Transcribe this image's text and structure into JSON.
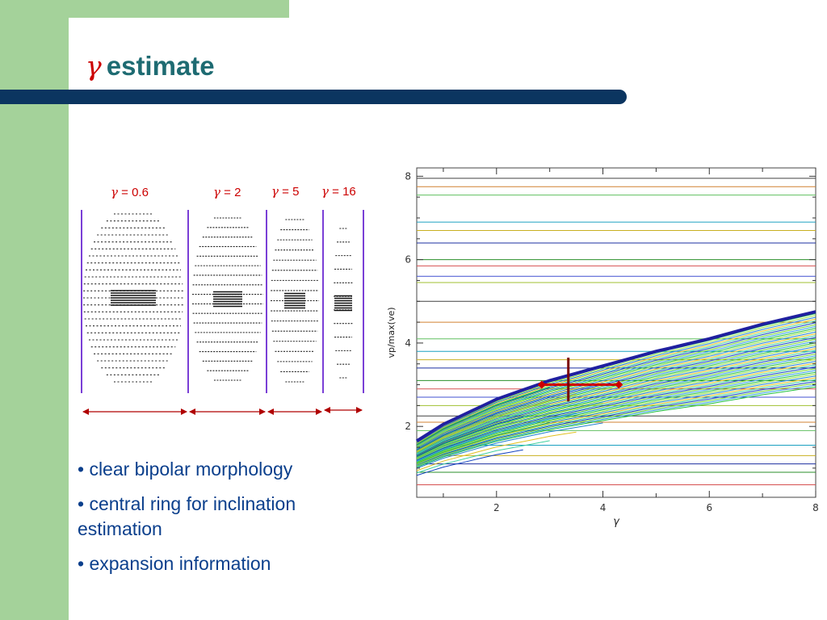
{
  "slide": {
    "title_symbol": "γ",
    "title_text": "estimate"
  },
  "panels": [
    {
      "symbol": "γ",
      "value": " = 0.6"
    },
    {
      "symbol": "γ",
      "value": " = 2"
    },
    {
      "symbol": "γ",
      "value": " = 5"
    },
    {
      "symbol": "γ",
      "value": " = 16"
    }
  ],
  "bullets": [
    "• clear bipolar morphology",
    "• central ring for inclination estimation",
    "• expansion information"
  ],
  "chart_data": {
    "type": "line",
    "xlabel": "γ",
    "ylabel": "vp/max(ve)",
    "xlim": [
      0.5,
      8
    ],
    "ylim": [
      0.3,
      8.2
    ],
    "xticks": [
      "2",
      "4",
      "6",
      "8"
    ],
    "yticks": [
      "2",
      "4",
      "6",
      "8"
    ],
    "grid": false,
    "estimate_point": {
      "x": 3.35,
      "y": 3.0,
      "x_err": [
        2.85,
        4.3
      ],
      "y_err": [
        2.6,
        3.65
      ]
    },
    "envelope_curve": {
      "x": [
        0.5,
        1,
        2,
        3,
        4,
        5,
        6,
        7,
        8
      ],
      "y": [
        1.65,
        2.05,
        2.65,
        3.1,
        3.45,
        3.8,
        4.1,
        4.45,
        4.75
      ]
    },
    "horizontal_levels": [
      0.6,
      0.9,
      1.1,
      1.3,
      1.55,
      1.9,
      2.1,
      2.25,
      2.5,
      2.7,
      2.9,
      3.1,
      3.4,
      3.6,
      3.8,
      4.1,
      4.5,
      5.0,
      5.45,
      5.6,
      5.85,
      6.0,
      6.4,
      6.7,
      6.9,
      7.55,
      7.75,
      7.95
    ]
  },
  "colors": {
    "sidebar_green": "#a4d29a",
    "rule_navy": "#0b3560",
    "title_teal": "#1e6b72",
    "accent_red": "#cc0000",
    "bullet_blue": "#0b3f8c",
    "panel_line": "#7a3fd6",
    "arrow_red": "#b00000",
    "curve_navy": "#2020a0",
    "estimate_marker": "#cc0000",
    "estimate_cross": "#7a0000"
  }
}
